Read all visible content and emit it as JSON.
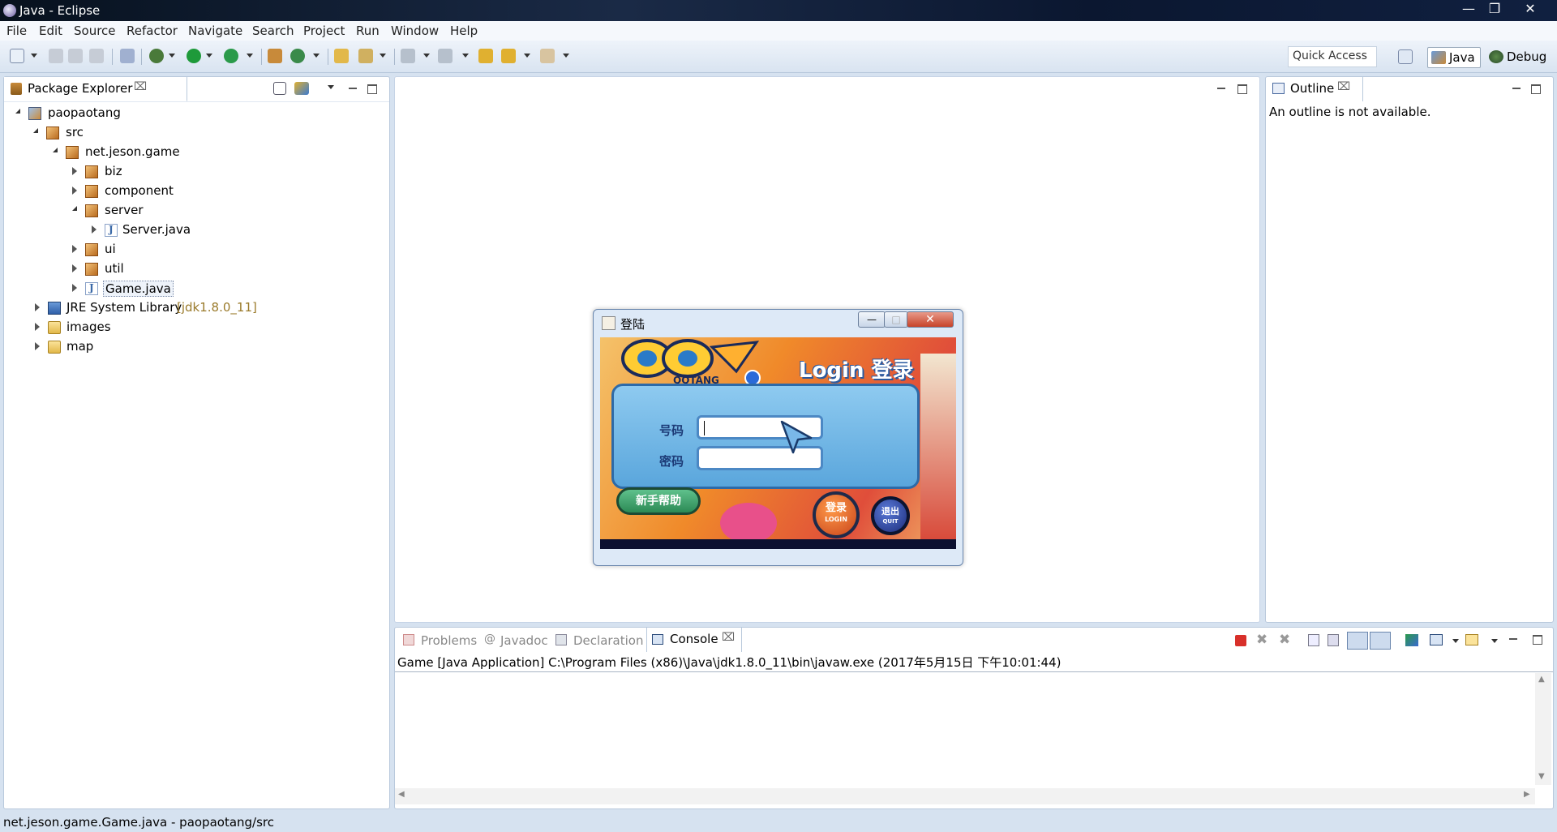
{
  "window": {
    "title": "Java - Eclipse"
  },
  "menu": [
    "File",
    "Edit",
    "Source",
    "Refactor",
    "Navigate",
    "Search",
    "Project",
    "Run",
    "Window",
    "Help"
  ],
  "toolbar": {
    "quick_access": "Quick Access"
  },
  "perspectives": {
    "java": "Java",
    "debug": "Debug"
  },
  "package_explorer": {
    "tab": "Package Explorer",
    "tree": [
      {
        "label": "paopaotang"
      },
      {
        "label": "src"
      },
      {
        "label": "net.jeson.game"
      },
      {
        "label": "biz"
      },
      {
        "label": "component"
      },
      {
        "label": "server"
      },
      {
        "label": "Server.java"
      },
      {
        "label": "ui"
      },
      {
        "label": "util"
      },
      {
        "label": "Game.java"
      },
      {
        "label": "JRE System Library",
        "suffix": "[jdk1.8.0_11]"
      },
      {
        "label": "images"
      },
      {
        "label": "map"
      }
    ]
  },
  "outline": {
    "tab": "Outline",
    "message": "An outline is not available."
  },
  "bottom_tabs": {
    "problems": "Problems",
    "javadoc": "Javadoc",
    "declaration": "Declaration",
    "console": "Console"
  },
  "console": {
    "header": "Game [Java Application] C:\\Program Files (x86)\\Java\\jdk1.8.0_11\\bin\\javaw.exe (2017年5月15日 下午10:01:44)"
  },
  "login_dialog": {
    "title": "登陆",
    "logo_text": "Login 登录",
    "brand": "QQTANG",
    "number_label": "号码",
    "password_label": "密码",
    "help_button": "新手帮助",
    "login_button": "登录",
    "login_button_en": "LOGIN",
    "quit_button": "退出",
    "quit_button_en": "QUIT"
  },
  "status": {
    "text": "net.jeson.game.Game.java - paopaotang/src"
  }
}
